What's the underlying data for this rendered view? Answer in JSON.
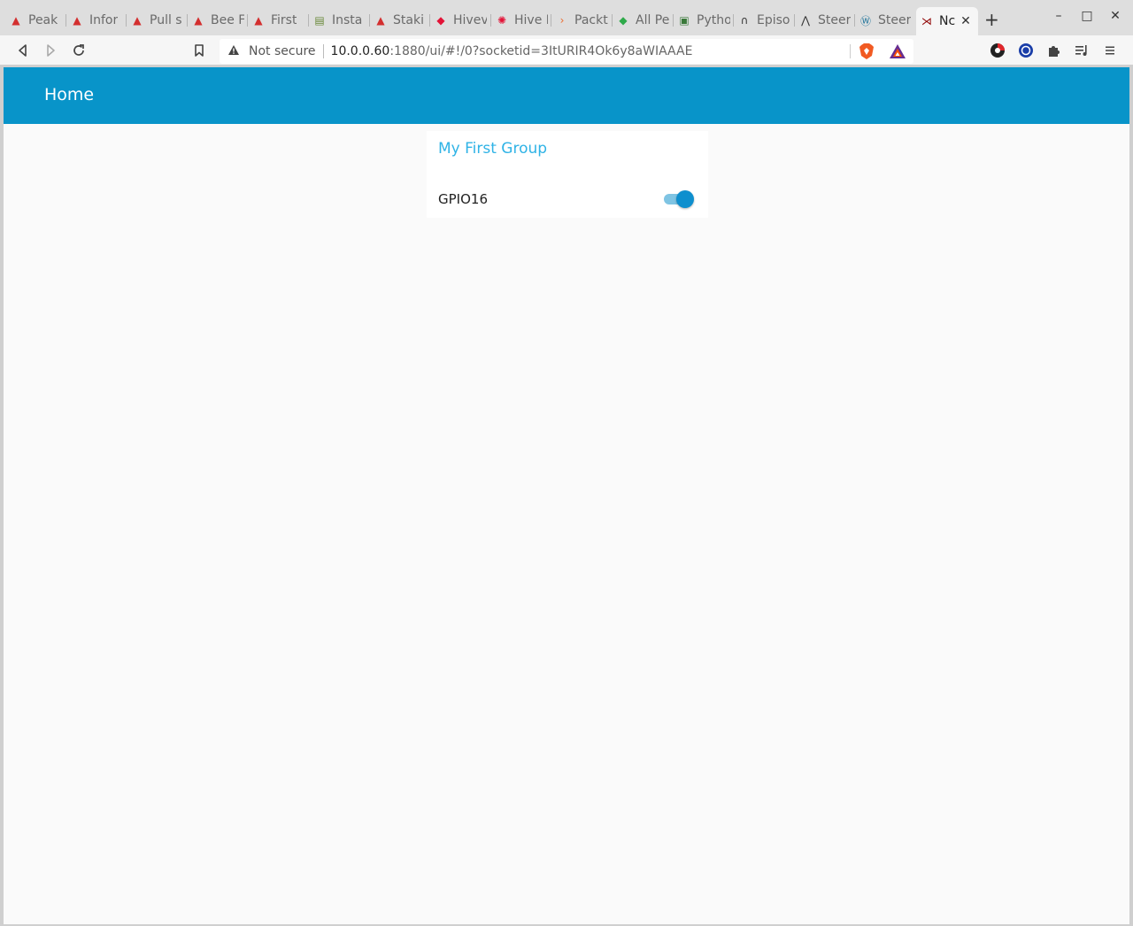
{
  "browser": {
    "tabs": [
      {
        "title": "Peak",
        "icon": "peakd-icon",
        "color": "#d32f2f"
      },
      {
        "title": "Infor",
        "icon": "peakd-icon",
        "color": "#d32f2f"
      },
      {
        "title": "Pull s",
        "icon": "peakd-icon",
        "color": "#d32f2f"
      },
      {
        "title": "Bee F",
        "icon": "peakd-icon",
        "color": "#d32f2f"
      },
      {
        "title": "First",
        "icon": "peakd-icon",
        "color": "#d32f2f"
      },
      {
        "title": "Insta",
        "icon": "document-icon",
        "color": "#6a8a3a"
      },
      {
        "title": "Staki",
        "icon": "peakd-icon",
        "color": "#d32f2f"
      },
      {
        "title": "Hivev",
        "icon": "hive-icon",
        "color": "#e31337"
      },
      {
        "title": "Hive I",
        "icon": "hive-gear-icon",
        "color": "#e31337"
      },
      {
        "title": "Packt",
        "icon": "packt-icon",
        "color": "#ec6b2d"
      },
      {
        "title": "All Pe",
        "icon": "diamond-icon",
        "color": "#2eaa4a"
      },
      {
        "title": "Pytho",
        "icon": "python-icon",
        "color": "#3a7a3a"
      },
      {
        "title": "Episo",
        "icon": "headphones-icon",
        "color": "#333333"
      },
      {
        "title": "Steer",
        "icon": "steem-icon",
        "color": "#333333"
      },
      {
        "title": "Steer",
        "icon": "wordpress-icon",
        "color": "#21759b"
      },
      {
        "title": "Nc",
        "icon": "node-red-icon",
        "color": "#8f0000",
        "active": true
      }
    ],
    "new_tab_label": "+",
    "window_controls": {
      "minimize": "–",
      "maximize": "□",
      "close": "✕"
    },
    "address_bar": {
      "security_label": "Not secure",
      "host": "10.0.0.60",
      "path": ":1880/ui/#!/0?socketid=3ItURIR4Ok6y8aWIAAAE"
    }
  },
  "dashboard": {
    "header_title": "Home",
    "header_color": "#0894c9",
    "group": {
      "title": "My First Group",
      "title_color": "#2fb3e6",
      "switch": {
        "label": "GPIO16",
        "state": "on",
        "color": "#0e8fce"
      }
    }
  }
}
